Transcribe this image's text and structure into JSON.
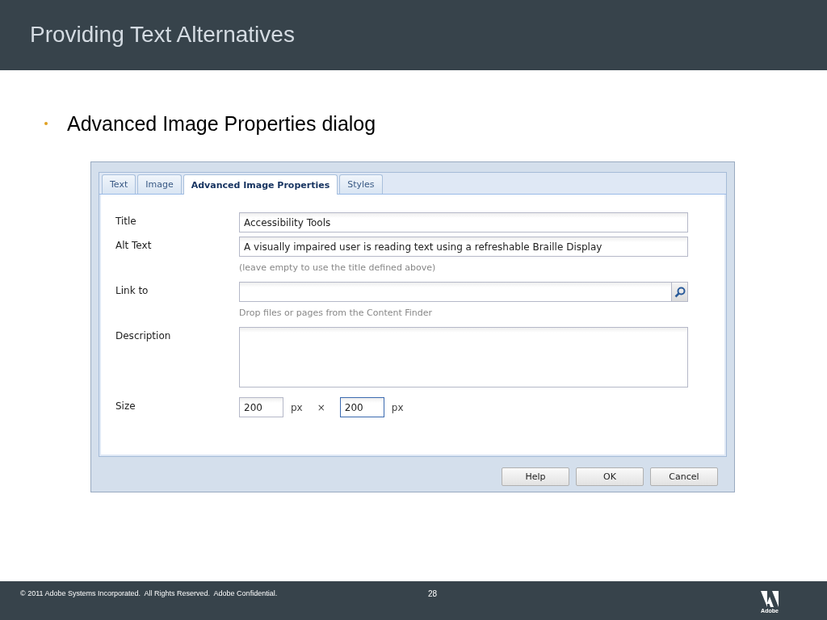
{
  "slide_title": "Providing Text Alternatives",
  "bullets": [
    "Advanced Image Properties dialog"
  ],
  "dialog": {
    "tabs": [
      {
        "label": "Text",
        "selected": false
      },
      {
        "label": "Image",
        "selected": false
      },
      {
        "label": "Advanced Image Properties",
        "selected": true
      },
      {
        "label": "Styles",
        "selected": false
      }
    ],
    "fields": [
      {
        "kind": "text",
        "label": "Title",
        "value": "Accessibility Tools"
      },
      {
        "kind": "text",
        "label": "Alt Text",
        "value": "A visually impaired user is reading text using a refreshable Braille Display",
        "hint": "(leave empty to use the title defined above)"
      },
      {
        "kind": "search",
        "label": "Link to",
        "hint": "Drop files or pages from the Content Finder"
      },
      {
        "kind": "textarea",
        "label": "Description"
      },
      {
        "kind": "size",
        "label": "Size",
        "inputs": [
          {
            "value": "200",
            "unit": "px",
            "focused": false
          },
          {
            "value": "200",
            "unit": "px",
            "focused": true
          }
        ],
        "separator": "×"
      }
    ],
    "buttons": [
      "Help",
      "OK",
      "Cancel"
    ]
  },
  "footer": {
    "copyright": "© 2011 Adobe Systems Incorporated.  All Rights Reserved.  Adobe Confidential.",
    "page": "28",
    "logo_text": "Adobe"
  }
}
